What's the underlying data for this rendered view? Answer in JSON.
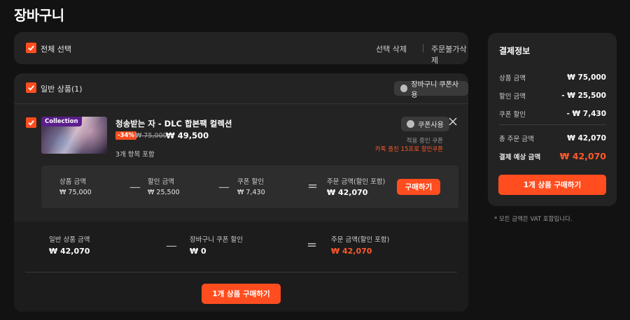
{
  "page": {
    "title": "장바구니"
  },
  "select_bar": {
    "select_all_label": "전체 선택",
    "delete_selected": "선택 삭제",
    "delete_unorderable": "주문불가삭제"
  },
  "group": {
    "title": "일반 상품(1)",
    "cart_coupon_button": "장바구니 쿠폰사용"
  },
  "product": {
    "thumb_badge": "Collection",
    "name": "청송받는 자 - DLC 합본팩 컬렉션",
    "discount_badge": "-34%",
    "original_price": "₩ 75,000",
    "sale_price": "₩ 49,500",
    "items_included": "3개 항목 포함",
    "coupon_button": "쿠폰사용",
    "applied_coupon_label": "적용 중인 쿠폰",
    "applied_coupon_name": "카톡 플친 15프로 할인쿠폰",
    "breakdown": {
      "product_amount_label": "상품 금액",
      "product_amount": "₩ 75,000",
      "discount_amount_label": "할인 금액",
      "discount_amount": "₩ 25,500",
      "coupon_discount_label": "쿠폰 할인",
      "coupon_discount": "₩ 7,430",
      "order_amount_label": "주문 금액(할인 포함)",
      "order_amount": "₩ 42,070",
      "buy_button": "구매하기"
    }
  },
  "group_summary": {
    "general_amount_label": "일반 상품 금액",
    "general_amount": "₩ 42,070",
    "cart_coupon_label": "장바구니 쿠폰 할인",
    "cart_coupon_amount": "₩ 0",
    "order_amount_label": "주문 금액(할인 포함)",
    "order_amount": "₩ 42,070",
    "buy_button": "1개 상품 구매하기"
  },
  "payment": {
    "title": "결제정보",
    "rows": [
      {
        "label": "상품 금액",
        "value": "₩ 75,000"
      },
      {
        "label": "할인 금액",
        "value": "- ₩ 25,500"
      },
      {
        "label": "쿠폰 할인",
        "value": "- ₩ 7,430"
      }
    ],
    "total_label": "총 주문 금액",
    "total_value": "₩ 42,070",
    "expected_label": "결제 예상 금액",
    "expected_value": "₩ 42,070",
    "buy_button": "1개 상품 구매하기",
    "vat_note": "* 모든 금액은 VAT 포함입니다."
  },
  "colors": {
    "accent": "#ff4d1f",
    "panel": "#232323",
    "background": "#121212"
  }
}
